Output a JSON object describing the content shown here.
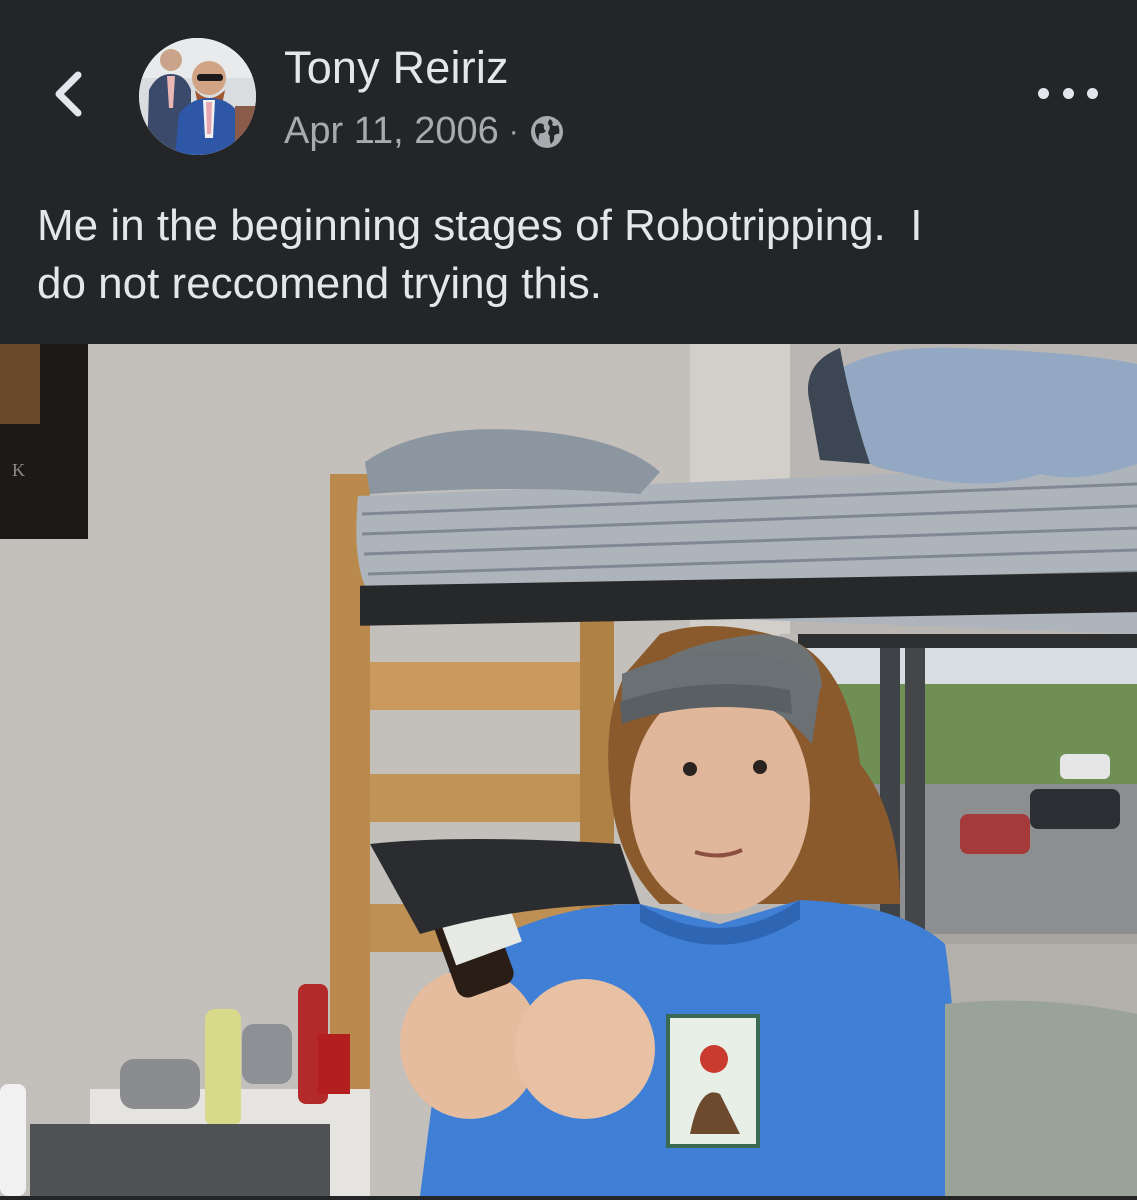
{
  "post": {
    "author": "Tony Reiriz",
    "date": "Apr 11, 2006",
    "separator": "·",
    "privacy_icon": "globe-icon",
    "text": "Me in the beginning stages of Robotripping.  I\ndo not reccomend trying this."
  },
  "header": {
    "back_icon": "chevron-left-icon",
    "more_icon": "more-horizontal-icon"
  },
  "photo": {
    "poster_fragment": "K"
  },
  "colors": {
    "background": "#242526",
    "primary_text": "#e4e6eb",
    "secondary_text": "#a8aaaf"
  }
}
